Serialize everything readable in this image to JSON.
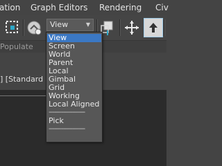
{
  "menubar": {
    "items": [
      {
        "label": "ation"
      },
      {
        "label": "Graph Editors"
      },
      {
        "label": "Rendering"
      },
      {
        "label": "Civ"
      }
    ]
  },
  "toolbar": {
    "reference_coordinate_system": {
      "value": "View"
    },
    "icons": [
      "select-region-icon",
      "select-manipulate-icon",
      "pivot-center-icon",
      "move-axis-icon",
      "keyboard-shortcut-override-icon"
    ]
  },
  "populate": {
    "label": "Populate"
  },
  "viewport": {
    "label": "] [Standard ] ["
  },
  "dropdown": {
    "options": [
      "View",
      "Screen",
      "World",
      "Parent",
      "Local",
      "Gimbal",
      "Grid",
      "Working",
      "Local Aligned"
    ],
    "separator": "--------------------",
    "extra_options": [
      "Pick"
    ],
    "selected": "View"
  },
  "colors": {
    "selection": "#3b78c4",
    "menu_bg": "#575757",
    "ui_bg": "#444444",
    "viewport_bg": "#2b2b2b"
  }
}
